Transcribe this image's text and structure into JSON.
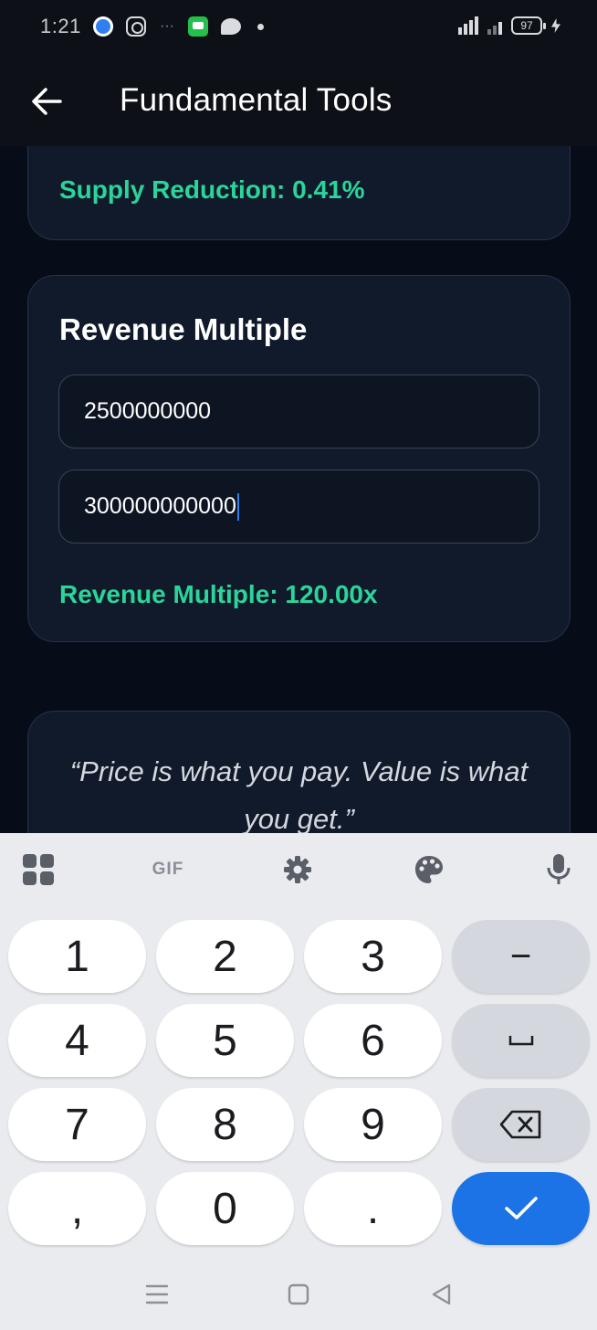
{
  "status_bar": {
    "time": "1:21",
    "battery": "97",
    "dots": "···"
  },
  "app_bar": {
    "title": "Fundamental Tools"
  },
  "supply_card": {
    "result": "Supply Reduction: 0.41%"
  },
  "revenue_card": {
    "title": "Revenue Multiple",
    "field_1_value": "2500000000",
    "field_2_value": "300000000000",
    "result": "Revenue Multiple: 120.00x"
  },
  "quote_card": {
    "line_1": "“Price is what you pay. Value is what",
    "line_2": "you get.”"
  },
  "keyboard": {
    "toolbar": {
      "gif_label": "GIF"
    },
    "keys": [
      "1",
      "2",
      "3",
      "−",
      "4",
      "5",
      "6",
      "␣",
      "7",
      "8",
      "9",
      "⌫",
      ",",
      "0",
      ".",
      "✓"
    ]
  },
  "colors": {
    "accent_green": "#2bd59a",
    "card_bg": "#111a2b",
    "enter_blue": "#1c73e6",
    "caret_blue": "#2f7ff0"
  }
}
